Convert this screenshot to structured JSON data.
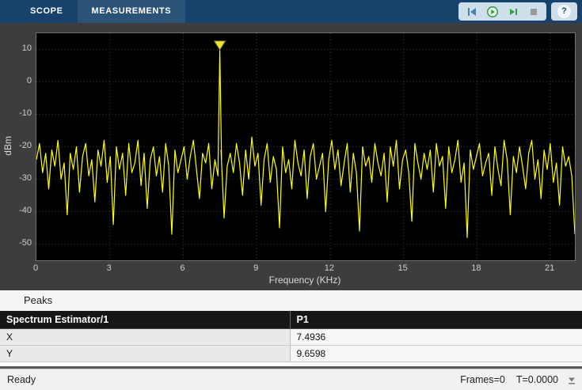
{
  "toolbar": {
    "tabs": [
      {
        "label": "SCOPE"
      },
      {
        "label": "MEASUREMENTS"
      }
    ],
    "help_glyph": "?",
    "buttons": [
      {
        "name": "step-back"
      },
      {
        "name": "run"
      },
      {
        "name": "step-forward"
      },
      {
        "name": "stop"
      },
      {
        "name": "help"
      }
    ]
  },
  "chart_data": {
    "type": "line",
    "title": "",
    "xlabel": "Frequency (KHz)",
    "ylabel": "dBm",
    "xlim": [
      0,
      22
    ],
    "ylim": [
      -55,
      15
    ],
    "x_ticks": [
      0,
      3,
      6,
      9,
      12,
      15,
      18,
      21
    ],
    "y_ticks": [
      10,
      0,
      -10,
      -20,
      -30,
      -40,
      -50
    ],
    "grid": true,
    "background": "#000000",
    "grid_color": "#3a3a3a",
    "series": [
      {
        "name": "Spectrum Estimator/1",
        "color": "#ffff00",
        "peak": {
          "x": 7.4936,
          "y": 9.6598
        },
        "peak_marker": "triangle-down",
        "noise_floor_dbm_values": [
          -24,
          -19,
          -28,
          -22,
          -33,
          -21,
          -26,
          -18,
          -30,
          -25,
          -41,
          -22,
          -27,
          -20,
          -34,
          -23,
          -19,
          -29,
          -24,
          -37,
          -21,
          -26,
          -18,
          -31,
          -23,
          -44,
          -20,
          -27,
          -22,
          -35,
          -19,
          -28,
          -25,
          -18,
          -32,
          -22,
          -39,
          -24,
          -20,
          -29,
          -23,
          -34,
          -19,
          -26,
          -47,
          -21,
          -28,
          -24,
          -20,
          -30,
          -23,
          -18,
          -27,
          -36,
          -22,
          -25,
          -19,
          -33,
          -24,
          -29,
          -21,
          -42,
          -26,
          -22,
          -28,
          -19,
          -25,
          -35,
          -21,
          -30,
          -17,
          -26,
          -22,
          -38,
          -24,
          -19,
          -31,
          -23,
          -27,
          -45,
          -20,
          -28,
          -24,
          -33,
          -18,
          -25,
          -29,
          -21,
          -36,
          -23,
          -19,
          -30,
          -26,
          -22,
          -40,
          -24,
          -18,
          -27,
          -21,
          -32,
          -25,
          -19,
          -34,
          -22,
          -28,
          -46,
          -20,
          -26,
          -23,
          -31,
          -19,
          -25,
          -29,
          -22,
          -37,
          -20,
          -26,
          -18,
          -33,
          -24,
          -21,
          -28,
          -43,
          -19,
          -25,
          -30,
          -22,
          -27,
          -21,
          -34,
          -19,
          -26,
          -23,
          -39,
          -20,
          -28,
          -24,
          -18,
          -31,
          -25,
          -48,
          -21,
          -27,
          -23,
          -19,
          -29,
          -25,
          -22,
          -35,
          -20,
          -27,
          -32,
          -18,
          -24,
          -41,
          -23,
          -28,
          -20,
          -26,
          -33,
          -22,
          -18,
          -30,
          -24,
          -36,
          -21,
          -27,
          -19,
          -31,
          -25,
          -38,
          -20,
          -26,
          -23,
          -29,
          -47
        ]
      }
    ]
  },
  "peaks_panel": {
    "title": "Peaks",
    "table": {
      "columns": [
        "Spectrum Estimator/1",
        "P1"
      ],
      "rows": [
        {
          "label": "X",
          "value": "7.4936"
        },
        {
          "label": "Y",
          "value": "9.6598"
        }
      ]
    }
  },
  "statusbar": {
    "left": "Ready",
    "frames": "Frames=0",
    "time": "T=0.0000"
  }
}
